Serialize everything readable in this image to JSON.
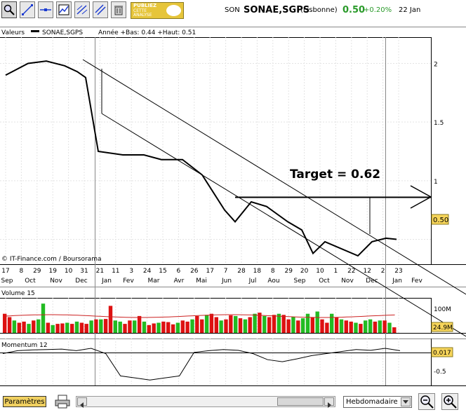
{
  "header": {
    "symbol_code": "SON",
    "name": "SONAE,SGPS",
    "exchange": "(Lisbonne)",
    "price": "0.50",
    "change": "+0.20%",
    "date": "22 Jan"
  },
  "toolbar": {
    "icons": [
      "zoom-icon",
      "line-icon",
      "hline-icon",
      "chart-icon",
      "trend-icon",
      "parallel-icon",
      "trash-icon"
    ],
    "ad_line1": "PUBLIEZ",
    "ad_line2": "CETTE",
    "ad_line3": "ANALYSE"
  },
  "colors": {
    "up": "#22bb22",
    "down": "#dd1111",
    "price_green": "#2a9a2a",
    "badge": "#f7d55a"
  },
  "price_panel": {
    "legend": "Valeurs",
    "series_name": "SONAE,SGPS",
    "range_text": "Année +Bas: 0.44 +Haut: 0.51",
    "y_ticks": [
      "2",
      "1.5",
      "1",
      "0.50"
    ],
    "last_badge": "0.50",
    "annotation": "Target = 0.62",
    "credit": "© IT-Finance.com / Boursorama",
    "x_top": [
      "17",
      "8",
      "29",
      "19",
      "10",
      "31",
      "21",
      "11",
      "3",
      "24",
      "15",
      "6",
      "26",
      "17",
      "7",
      "28",
      "18",
      "8",
      "29",
      "20",
      "10",
      "1",
      "22",
      "12",
      "2",
      "23"
    ],
    "x_bottom": [
      "Sep",
      "Oct",
      "Nov",
      "Dec",
      "Jan",
      "Fev",
      "Mar",
      "Avr",
      "Mai",
      "Jun",
      "Jul",
      "Aou",
      "Sep",
      "Oct",
      "Nov",
      "Dec",
      "Jan",
      "Fev"
    ]
  },
  "volume_panel": {
    "title": "Volume 15",
    "tick": "100M",
    "last_badge": "24.9M"
  },
  "momentum_panel": {
    "title": "Momentum 12",
    "tick": "-0.5",
    "last_badge": "0.017"
  },
  "chart_data": [
    {
      "type": "line",
      "title": "SONAE,SGPS",
      "x": [
        "2007-09-17",
        "2007-10-08",
        "2007-10-29",
        "2007-11-19",
        "2007-12-10",
        "2007-12-31",
        "2008-01-21",
        "2008-02-11",
        "2008-03-03",
        "2008-03-24",
        "2008-04-14",
        "2008-05-05",
        "2008-05-26",
        "2008-06-16",
        "2008-07-07",
        "2008-07-28",
        "2008-08-18",
        "2008-09-08",
        "2008-09-29",
        "2008-10-20",
        "2008-11-10",
        "2008-12-01",
        "2008-12-22",
        "2009-01-12"
      ],
      "y": [
        1.9,
        2.0,
        2.02,
        1.98,
        1.93,
        1.88,
        1.25,
        1.22,
        1.22,
        1.18,
        1.18,
        1.05,
        0.75,
        0.65,
        0.82,
        0.78,
        0.65,
        0.58,
        0.38,
        0.48,
        0.36,
        0.48,
        0.51,
        0.5
      ],
      "ylim": [
        0.3,
        2.2
      ],
      "annotation": "Target = 0.62"
    },
    {
      "type": "bar",
      "title": "Volume 15",
      "values": [
        85,
        70,
        55,
        45,
        50,
        40,
        55,
        60,
        130,
        45,
        35,
        40,
        42,
        45,
        40,
        50,
        45,
        40,
        55,
        60,
        60,
        62,
        120,
        55,
        50,
        40,
        55,
        55,
        75,
        50,
        35,
        42,
        45,
        50,
        48,
        38,
        45,
        55,
        50,
        60,
        75,
        60,
        80,
        85,
        70,
        55,
        60,
        78,
        75,
        65,
        60,
        70,
        85,
        90,
        75,
        70,
        80,
        85,
        80,
        60,
        70,
        55,
        65,
        85,
        70,
        95,
        60,
        45,
        85,
        70,
        60,
        55,
        50,
        45,
        40,
        55,
        60,
        50,
        55,
        55,
        45,
        25
      ],
      "colors": [
        "down",
        "down",
        "up",
        "down",
        "down",
        "up",
        "down",
        "up",
        "up",
        "down",
        "up",
        "down",
        "down",
        "up",
        "down",
        "up",
        "down",
        "down",
        "up",
        "down",
        "up",
        "down",
        "down",
        "up",
        "up",
        "down",
        "down",
        "up",
        "down",
        "up",
        "down",
        "down",
        "up",
        "down",
        "down",
        "down",
        "up",
        "down",
        "down",
        "up",
        "down",
        "down",
        "up",
        "down",
        "down",
        "up",
        "down",
        "down",
        "up",
        "down",
        "up",
        "down",
        "up",
        "down",
        "up",
        "down",
        "down",
        "up",
        "down",
        "down",
        "up",
        "down",
        "up",
        "up",
        "down",
        "up",
        "down",
        "down",
        "up",
        "down",
        "up",
        "down",
        "down",
        "up",
        "down",
        "up",
        "up",
        "down",
        "up",
        "down",
        "up",
        "down"
      ]
    },
    {
      "type": "line",
      "title": "Momentum 12",
      "values": [
        -0.05,
        0.02,
        0.04,
        0.05,
        0.06,
        0.02,
        0.08,
        -0.05,
        -0.6,
        -0.65,
        -0.7,
        -0.65,
        -0.6,
        -0.02,
        0.02,
        0.05,
        0.03,
        -0.05,
        -0.2,
        -0.25,
        -0.18,
        -0.1,
        -0.05,
        0.0,
        0.05,
        0.03,
        0.08,
        0.02
      ],
      "ylim": [
        -0.8,
        0.2
      ]
    }
  ]
}
